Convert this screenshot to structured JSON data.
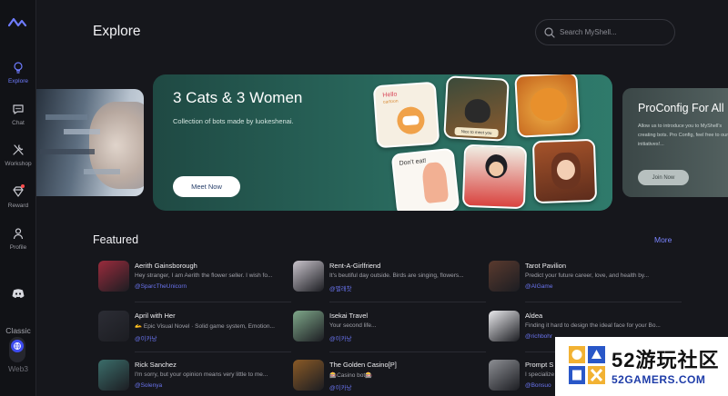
{
  "sidebar": {
    "items": [
      {
        "label": "Explore"
      },
      {
        "label": "Chat"
      },
      {
        "label": "Workshop"
      },
      {
        "label": "Reward"
      },
      {
        "label": "Profile"
      }
    ],
    "classic_label": "Classic",
    "web3_label": "Web3"
  },
  "header": {
    "title": "Explore",
    "search_placeholder": "Search MyShell..."
  },
  "banner": {
    "main": {
      "title": "3 Cats & 3 Women",
      "subtitle": "Collection of bots made by luokeshenai.",
      "button": "Meet Now",
      "tile_texts": {
        "hello": "Hello",
        "hello_sub": "cartoon",
        "nice": "Nice to meet you",
        "dont_eat": "Don't eat!"
      }
    },
    "right": {
      "title": "ProConfig For All",
      "description": "Allow us to introduce you to MyShell's creating bots. Pro Config, feel free to our initiatives!...",
      "button": "Join Now"
    }
  },
  "featured": {
    "title": "Featured",
    "more": "More",
    "bots": [
      {
        "name": "Aerith Gainsborough",
        "desc": "Hey stranger, I am Aerith the flower seller. I wish fo...",
        "creator": "@SparcTheUnicorn",
        "avatar_color": "#9a2b3c"
      },
      {
        "name": "Rent-A-Girlfriend",
        "desc": "It's beutiful day outside. Birds are singing, flowers...",
        "creator": "@별래찻",
        "avatar_color": "#c9c4cc"
      },
      {
        "name": "Tarot Pavilion",
        "desc": "Predict your future career, love, and health by...",
        "creator": "@AIGame",
        "avatar_color": "#5a3a2e"
      },
      {
        "name": "April with Her",
        "desc": "🫴 Epic Visual Novel · Solid game system, Emotion...",
        "creator": "@이카낭",
        "avatar_color": "#2c2d35"
      },
      {
        "name": "Isekai Travel",
        "desc": "Your second life...",
        "creator": "@이카낭",
        "avatar_color": "#7fa88a"
      },
      {
        "name": "Aldea",
        "desc": "Finding it hard to design the ideal face for your Bo...",
        "creator": "@richbohr",
        "avatar_color": "#e9e9ec"
      },
      {
        "name": "Rick Sanchez",
        "desc": "I'm sorry, but your opinion means very little to me...",
        "creator": "@Solenya",
        "avatar_color": "#3b6d6a"
      },
      {
        "name": "The Golden Casino[P]",
        "desc": "🎰Casino bot🎰",
        "creator": "@이카낭",
        "avatar_color": "#8a5a26"
      },
      {
        "name": "Prompt S",
        "desc": "I specialize",
        "creator": "@Bonsuo",
        "avatar_color": "#8d8f94"
      }
    ]
  },
  "watermark": {
    "big": "52游玩社区",
    "small": "52GAMERS.COM"
  },
  "colors": {
    "accent": "#6f7cff",
    "background": "#16171c",
    "hero": "#2a6b5f"
  }
}
